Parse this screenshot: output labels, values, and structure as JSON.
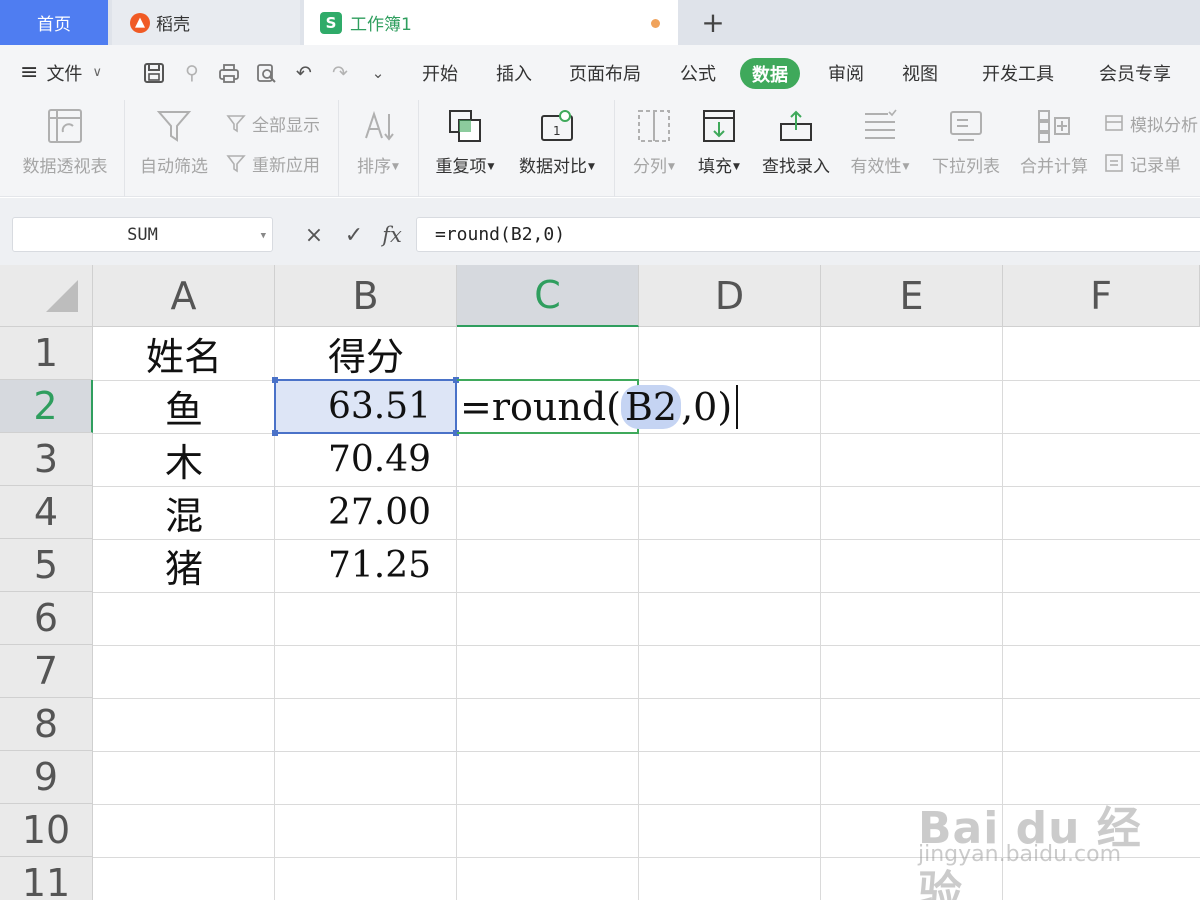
{
  "tabs": {
    "home": "首页",
    "daoke": "稻壳",
    "book": "工作簿1",
    "add": "+"
  },
  "menu": {
    "file": "文件",
    "tabs": [
      "开始",
      "插入",
      "页面布局",
      "公式",
      "数据",
      "审阅",
      "视图",
      "开发工具",
      "会员专享"
    ],
    "active_tab": "数据"
  },
  "ribbon": {
    "pivot": "数据透视表",
    "autofilter": "自动筛选",
    "show_all": "全部显示",
    "reapply": "重新应用",
    "sort": "排序",
    "duplicates": "重复项",
    "compare": "数据对比",
    "split": "分列",
    "fill": "填充",
    "lookup_entry": "查找录入",
    "validity": "有效性",
    "dropdown_list": "下拉列表",
    "consolidate": "合并计算",
    "simulate": "模拟分析",
    "record_form": "记录单"
  },
  "formula_bar": {
    "name_box": "SUM",
    "cancel": "×",
    "confirm": "✓",
    "fx": "fx",
    "formula": "=round(B2,0)"
  },
  "sheet": {
    "columns": [
      "A",
      "B",
      "C",
      "D",
      "E",
      "F"
    ],
    "rows": [
      "1",
      "2",
      "3",
      "4",
      "5",
      "6",
      "7",
      "8",
      "9",
      "10",
      "11"
    ],
    "selected_column": "C",
    "selected_row": "2",
    "cells": {
      "A1": "姓名",
      "B1": "得分",
      "A2": "鱼",
      "B2": "63.51",
      "A3": "木",
      "B3": "70.49",
      "A4": "混",
      "B4": "27.00",
      "A5": "猪",
      "B5": "71.25"
    },
    "editor": {
      "prefix": "=round(",
      "ref": "B2",
      "suffix": ",0)"
    }
  },
  "watermark": {
    "brand": "Bai du 经验",
    "url": "jingyan.baidu.com"
  },
  "colors": {
    "accent_green": "#3fa95b",
    "tab_blue": "#4f7df1",
    "selection_blue": "#4a72c8"
  }
}
